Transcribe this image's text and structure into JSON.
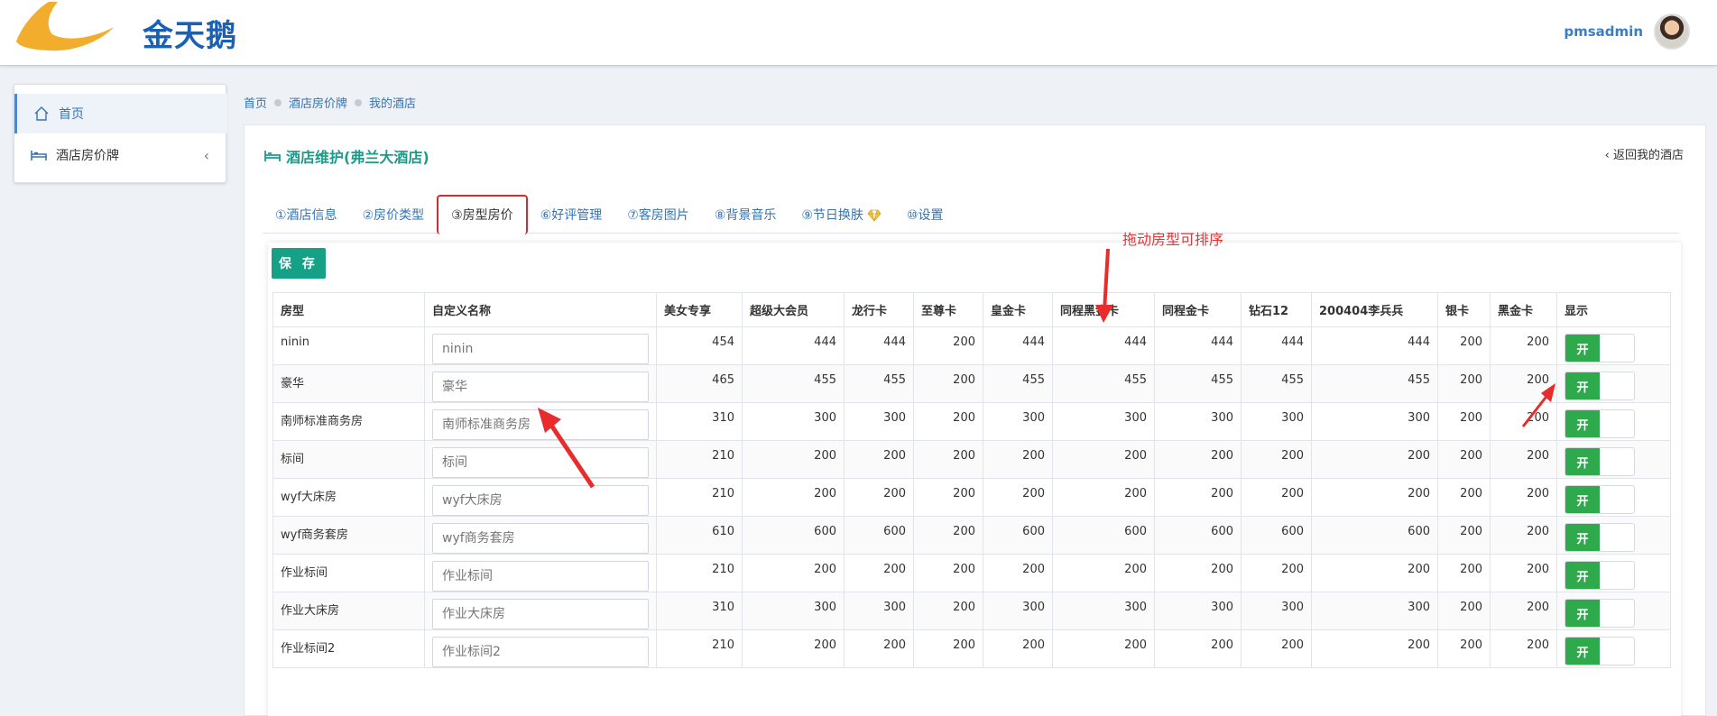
{
  "header": {
    "logo_text": "金天鹅",
    "username": "pmsadmin"
  },
  "sidebar": {
    "items": [
      {
        "label": "首页",
        "icon": "home-icon"
      },
      {
        "label": "酒店房价牌",
        "icon": "bed-icon"
      }
    ]
  },
  "breadcrumb": [
    "首页",
    "酒店房价牌",
    "我的酒店"
  ],
  "panel": {
    "title": "酒店维护(弗兰大酒店)",
    "back": "返回我的酒店"
  },
  "tabs": [
    "①酒店信息",
    "②房价类型",
    "③房型房价",
    "⑥好评管理",
    "⑦客房图片",
    "⑧背景音乐",
    "⑨节日换肤",
    "⑩设置"
  ],
  "save_label": "保 存",
  "table": {
    "headers": [
      "房型",
      "自定义名称",
      "美女专享",
      "超级大会员",
      "龙行卡",
      "至尊卡",
      "皇金卡",
      "同程黑金卡",
      "同程金卡",
      "钻石12",
      "200404李兵兵",
      "银卡",
      "黑金卡",
      "显示"
    ],
    "rows": [
      {
        "name": "ninin",
        "custom": "ninin",
        "prices": [
          454,
          444,
          444,
          200,
          444,
          444,
          444,
          444,
          444,
          200,
          200
        ],
        "toggle": "开"
      },
      {
        "name": "豪华",
        "custom": "豪华",
        "prices": [
          465,
          455,
          455,
          200,
          455,
          455,
          455,
          455,
          455,
          200,
          200
        ],
        "toggle": "开"
      },
      {
        "name": "南师标准商务房",
        "custom": "南师标准商务房",
        "prices": [
          310,
          300,
          300,
          200,
          300,
          300,
          300,
          300,
          300,
          200,
          200
        ],
        "toggle": "开"
      },
      {
        "name": "标间",
        "custom": "标间",
        "prices": [
          210,
          200,
          200,
          200,
          200,
          200,
          200,
          200,
          200,
          200,
          200
        ],
        "toggle": "开"
      },
      {
        "name": "wyf大床房",
        "custom": "wyf大床房",
        "prices": [
          210,
          200,
          200,
          200,
          200,
          200,
          200,
          200,
          200,
          200,
          200
        ],
        "toggle": "开"
      },
      {
        "name": "wyf商务套房",
        "custom": "wyf商务套房",
        "prices": [
          610,
          600,
          600,
          200,
          600,
          600,
          600,
          600,
          600,
          200,
          200
        ],
        "toggle": "开"
      },
      {
        "name": "作业标间",
        "custom": "作业标间",
        "prices": [
          210,
          200,
          200,
          200,
          200,
          200,
          200,
          200,
          200,
          200,
          200
        ],
        "toggle": "开"
      },
      {
        "name": "作业大床房",
        "custom": "作业大床房",
        "prices": [
          310,
          300,
          300,
          200,
          300,
          300,
          300,
          300,
          300,
          200,
          200
        ],
        "toggle": "开"
      },
      {
        "name": "作业标间2",
        "custom": "作业标间2",
        "prices": [
          210,
          200,
          200,
          200,
          200,
          200,
          200,
          200,
          200,
          200,
          200
        ],
        "toggle": "开"
      }
    ]
  },
  "annotation": {
    "text": "拖动房型可排序"
  }
}
